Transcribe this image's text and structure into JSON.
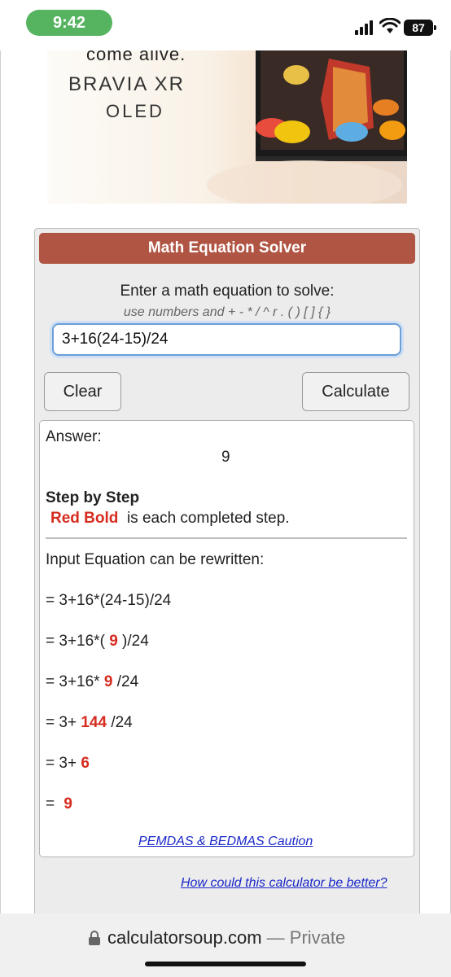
{
  "status_bar": {
    "time": "9:42",
    "battery": "87",
    "icons": [
      "signal-icon",
      "wifi-icon",
      "battery-icon"
    ]
  },
  "ad": {
    "subtitle": "come alive.",
    "brand": "BRAVIA XR",
    "line2": "OLED"
  },
  "calculator": {
    "title": "Math Equation Solver",
    "prompt": "Enter a math equation to solve:",
    "hint": "use numbers and + - * / ^ r . ( ) [ ] { }",
    "input_value": "3+16(24-15)/24",
    "clear_label": "Clear",
    "calculate_label": "Calculate",
    "colors": {
      "title_bar": "#b05543",
      "step_highlight": "#d62b1f",
      "link": "#1a28c8"
    }
  },
  "answer": {
    "label": "Answer:",
    "value": "9",
    "step_heading": "Step by Step",
    "legend_red": "Red Bold",
    "legend_rest": "is each completed step.",
    "rewrite_note": "Input Equation can be rewritten:",
    "steps": [
      {
        "pre": "= 3+16*(24-15)/24",
        "red": "",
        "post": ""
      },
      {
        "pre": "= 3+16*(",
        "red": "9",
        "post": ")/24"
      },
      {
        "pre": "= 3+16*",
        "red": "9",
        "post": "/24"
      },
      {
        "pre": "= 3+",
        "red": "144",
        "post": "/24"
      },
      {
        "pre": "= 3+",
        "red": "6",
        "post": ""
      },
      {
        "pre": "=",
        "red": "9",
        "post": ""
      }
    ],
    "caution_link": "PEMDAS & BEDMAS Caution"
  },
  "feedback_link": "How could this calculator be better?",
  "browser": {
    "domain": "calculatorsoup.com",
    "private_label": "— Private"
  }
}
